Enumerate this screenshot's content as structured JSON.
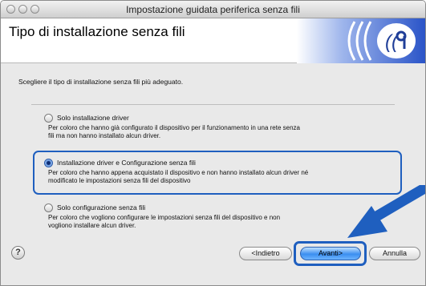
{
  "window": {
    "title": "Impostazione guidata periferica senza fili"
  },
  "header": {
    "page_title": "Tipo di installazione senza fili"
  },
  "intro_text": "Scegliere il tipo di installazione senza fili più adeguato.",
  "options": [
    {
      "label": "Solo installazione driver",
      "desc_line1": "Per coloro che hanno già configurato il dispositivo per il funzionamento in una rete senza",
      "desc_line2": "fili ma non hanno installato alcun driver.",
      "checked": false
    },
    {
      "label": "Installazione driver e Configurazione senza fili",
      "desc_line1": "Per coloro che hanno appena acquistato il dispositivo e non hanno installato alcun driver né",
      "desc_line2": "modificato le impostazioni senza fili del dispositivo",
      "checked": true
    },
    {
      "label": "Solo configurazione senza fili",
      "desc_line1": "Per coloro che vogliono configurare le impostazioni senza fili del dispositivo e non",
      "desc_line2": "vogliono installare alcun driver.",
      "checked": false
    }
  ],
  "buttons": {
    "help": "?",
    "back": "<Indietro",
    "next": "Avanti>",
    "cancel": "Annulla"
  },
  "colors": {
    "highlight": "#1f5fbf",
    "primary_button": "#3b8ef0",
    "logo_blue": "#2a54c8"
  },
  "icons": {
    "logo": "wireless-signal-icon",
    "annotation": "blue-arrow-icon"
  }
}
